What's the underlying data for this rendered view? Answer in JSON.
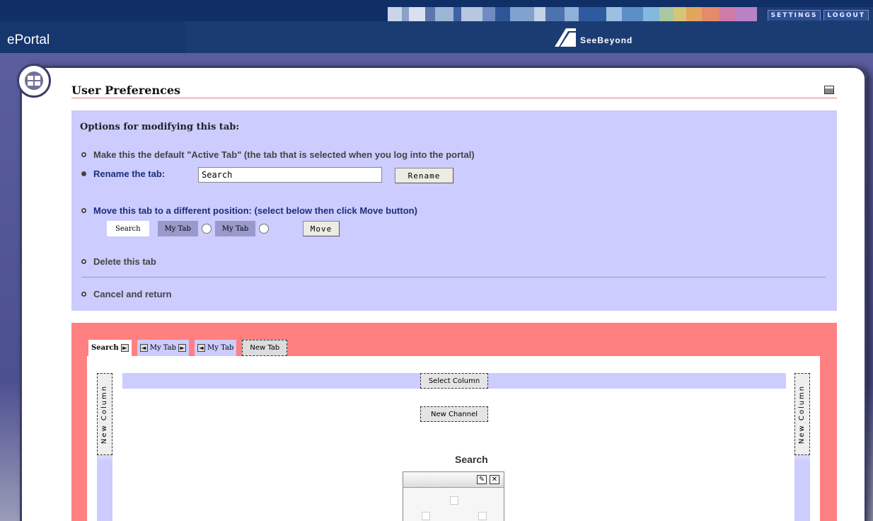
{
  "brand": {
    "app_title": "ePortal",
    "logo_text": "SeeBeyond"
  },
  "top_links": {
    "settings": "SETTINGS",
    "logout": "LOGOUT"
  },
  "colors": {
    "header_dark": "#0f2f66",
    "options_bg": "#ccccff",
    "layout_bg": "#ff8080",
    "frame": "#5a5d9e"
  },
  "page": {
    "title": "User Preferences"
  },
  "options": {
    "heading": "Options for modifying this tab:",
    "make_default": "Make this the default \"Active Tab\" (the tab that is selected when you log into the portal)",
    "rename_label": "Rename the tab:",
    "rename_value": "Search",
    "rename_button": "Rename",
    "move_label": "Move this tab to a different position: (select below then click Move button)",
    "tab_order": [
      "Search",
      "My Tab",
      "My Tab"
    ],
    "move_button": "Move",
    "delete": "Delete this tab",
    "cancel": "Cancel and return"
  },
  "layout": {
    "tabs": [
      {
        "label": "Search",
        "active": true
      },
      {
        "label": "My Tab",
        "active": false
      },
      {
        "label": "My Tab",
        "active": false
      }
    ],
    "new_tab": "New Tab",
    "new_column": "New Column",
    "select_column": "Select Column",
    "new_channel": "New Channel",
    "channel_title": "Search"
  },
  "icons": {
    "grid": "grid-icon",
    "maximize": "maximize-icon",
    "edit": "edit-icon",
    "close": "close-icon",
    "arrow_left": "arrow-left-icon",
    "arrow_right": "arrow-right-icon"
  }
}
